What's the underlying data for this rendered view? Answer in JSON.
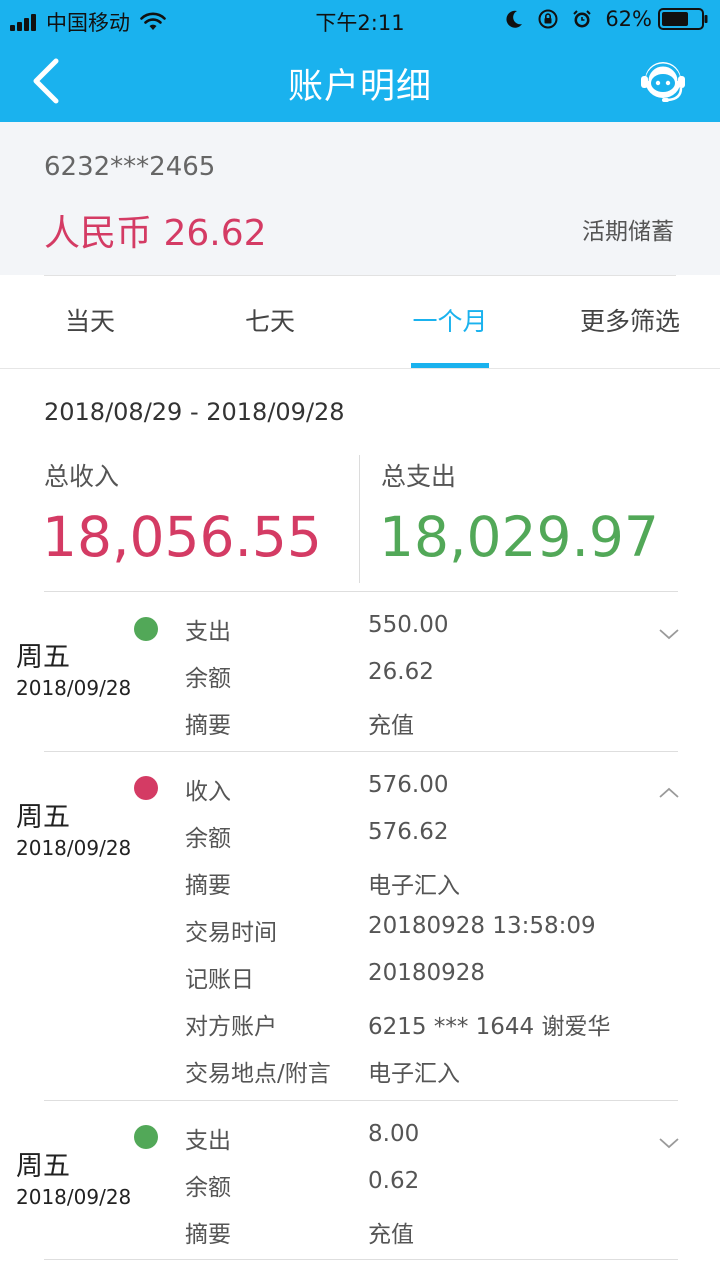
{
  "status_bar": {
    "carrier": "中国移动",
    "time": "下午2:11",
    "battery": "62%"
  },
  "nav": {
    "title": "账户明细",
    "back_icon": "back-arrow-icon",
    "service_icon": "customer-service-icon"
  },
  "account": {
    "number": "6232***2465",
    "balance": "人民币 26.62",
    "type": "活期储蓄"
  },
  "tabs": [
    {
      "label": "当天",
      "active": false
    },
    {
      "label": "七天",
      "active": false
    },
    {
      "label": "一个月",
      "active": true
    },
    {
      "label": "更多筛选",
      "active": false
    }
  ],
  "summary": {
    "date_range": "2018/08/29 - 2018/09/28",
    "income_label": "总收入",
    "income_value": "18,056.55",
    "expense_label": "总支出",
    "expense_value": "18,029.97"
  },
  "colors": {
    "brand": "#1ab2ee",
    "income": "#d43b64",
    "expense": "#52a858"
  },
  "transactions": [
    {
      "weekday": "周五",
      "date": "2018/09/28",
      "kind": "expense",
      "expanded": false,
      "rows": [
        {
          "label": "支出",
          "value": "550.00"
        },
        {
          "label": "余额",
          "value": "26.62"
        },
        {
          "label": "摘要",
          "value": "充值"
        }
      ]
    },
    {
      "weekday": "周五",
      "date": "2018/09/28",
      "kind": "income",
      "expanded": true,
      "rows": [
        {
          "label": "收入",
          "value": "576.00"
        },
        {
          "label": "余额",
          "value": "576.62"
        },
        {
          "label": "摘要",
          "value": "电子汇入"
        },
        {
          "label": "交易时间",
          "value": "20180928 13:58:09"
        },
        {
          "label": "记账日",
          "value": "20180928"
        },
        {
          "label": "对方账户",
          "value": "6215 *** 1644 谢爱华"
        },
        {
          "label": "交易地点/附言",
          "value": "电子汇入"
        }
      ]
    },
    {
      "weekday": "周五",
      "date": "2018/09/28",
      "kind": "expense",
      "expanded": false,
      "rows": [
        {
          "label": "支出",
          "value": "8.00"
        },
        {
          "label": "余额",
          "value": "0.62"
        },
        {
          "label": "摘要",
          "value": "充值"
        }
      ]
    }
  ]
}
